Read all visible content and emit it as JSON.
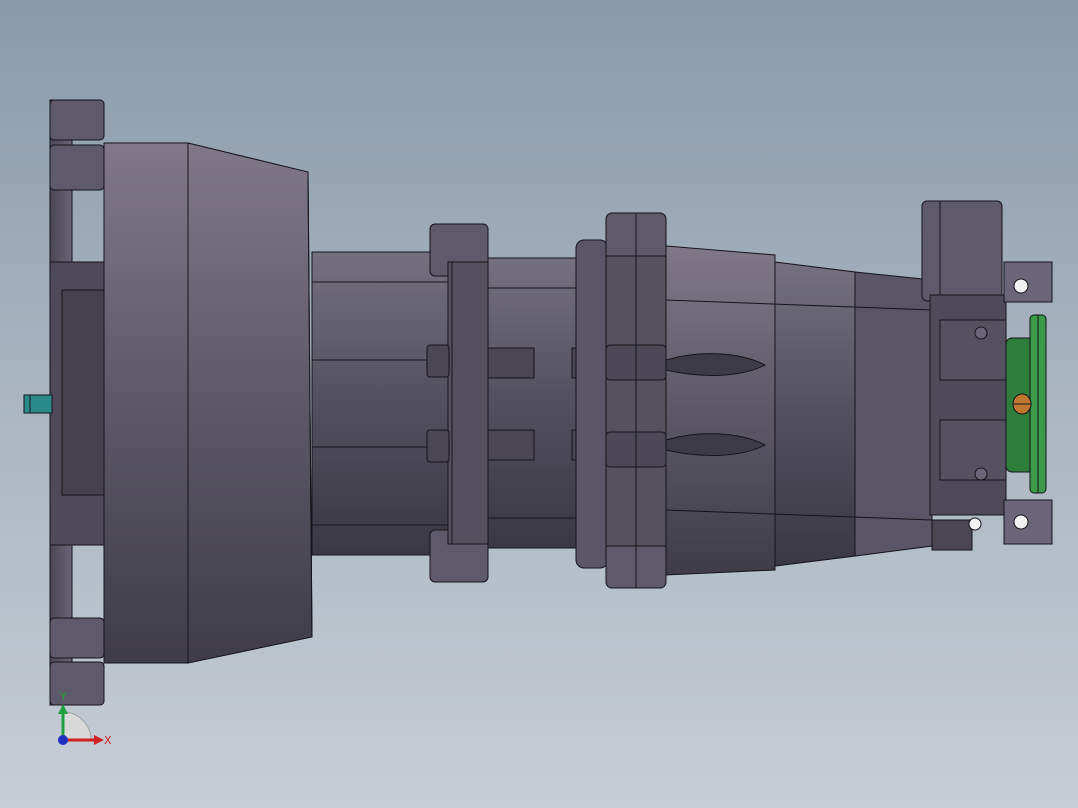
{
  "viewport": {
    "background_top": "#8a9aaa",
    "background_bottom": "#c6ced6"
  },
  "model": {
    "body_color": "#5c5868",
    "body_light": "#7a7586",
    "edge_color": "#15131a",
    "coupling_color": "#2e7d3a",
    "fitting_color": "#c07830",
    "shaft_color": "#2a8a8a"
  },
  "triad": {
    "x_label": "X",
    "y_label": "Y",
    "x_color": "#d02020",
    "y_color": "#20a040",
    "z_color": "#2030c0"
  }
}
